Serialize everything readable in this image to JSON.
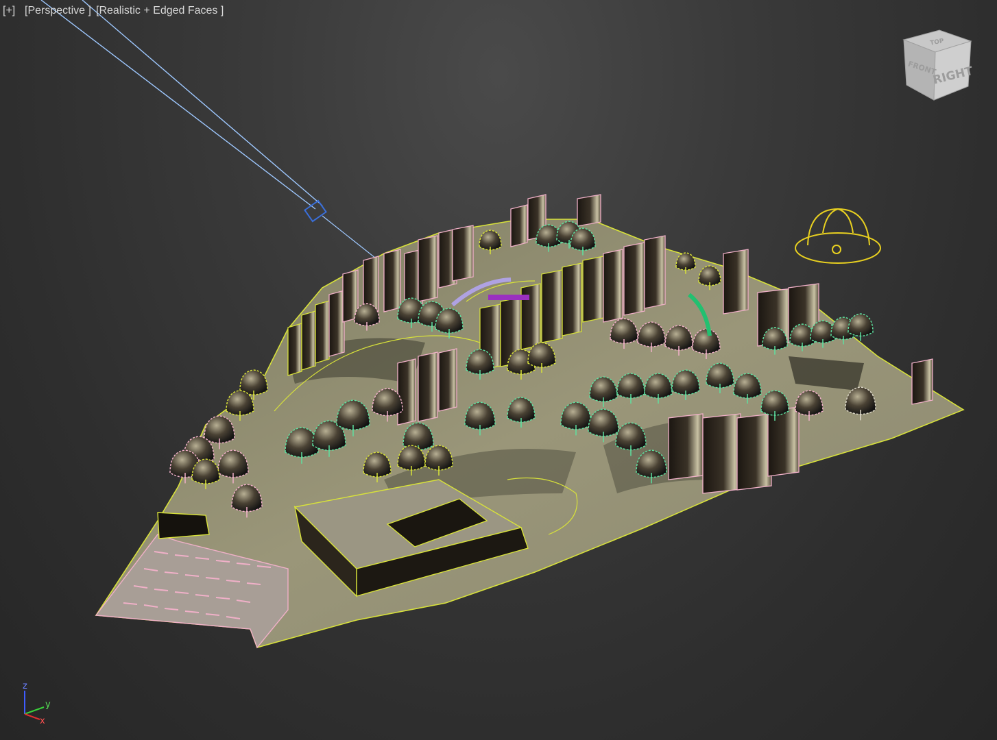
{
  "viewport": {
    "label_plus": "[+]",
    "label_view": "[Perspective ]",
    "label_shading": "[Realistic + Edged Faces ]"
  },
  "viewcube": {
    "face_right": "RIGHT",
    "face_front": "FRONT",
    "face_top": "TOP"
  },
  "axis_tripod": {
    "x": "x",
    "y": "y",
    "z": "z"
  },
  "colors": {
    "background": "#3a3a3a",
    "edge_yellow": "#d8e23a",
    "edge_pink": "#f0b0c8",
    "edge_cyan": "#5ee0a0",
    "camera_line": "#9ec8ff",
    "sun_helper": "#e8d020",
    "ground": "#8f8c6f"
  }
}
